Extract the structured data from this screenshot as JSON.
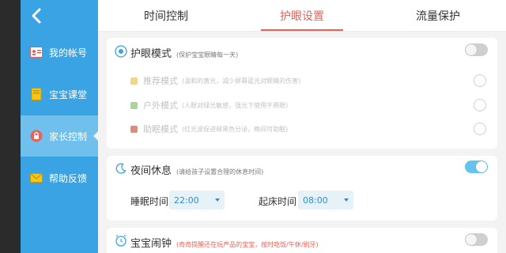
{
  "sidebar": {
    "items": [
      {
        "label": "我的帐号",
        "icon": "account-card-icon"
      },
      {
        "label": "宝宝课堂",
        "icon": "notebook-icon"
      },
      {
        "label": "家长控制",
        "icon": "lock-icon",
        "active": true
      },
      {
        "label": "帮助反馈",
        "icon": "envelope-icon"
      }
    ]
  },
  "tabs": [
    {
      "label": "时间控制"
    },
    {
      "label": "护眼设置",
      "active": true
    },
    {
      "label": "流量保护"
    }
  ],
  "eye_care": {
    "title": "护眼模式",
    "subtitle": "(保护宝宝眼睛每一天)",
    "enabled": false,
    "modes": [
      {
        "name": "推荐模式",
        "desc": "(温和的黄光，减少屏幕蓝光对眼睛的伤害)",
        "color": "#f2d58a"
      },
      {
        "name": "户外模式",
        "desc": "(人眼对绿光敏感，强光下使用不费眼)",
        "color": "#a9d59a"
      },
      {
        "name": "助眠模式",
        "desc": "(红光波促进褪黑色分泌，晚间可助眠)",
        "color": "#e08b7c"
      }
    ]
  },
  "night_rest": {
    "title": "夜间休息",
    "subtitle": "(请给孩子设置合理的休息时间)",
    "enabled": true,
    "sleep_label": "睡眠时间",
    "sleep_value": "22:00",
    "wake_label": "起床时间",
    "wake_value": "08:00"
  },
  "alarm": {
    "title": "宝宝闹钟",
    "subtitle": "(奇奇提醒还在玩产品的宝宝，按时吃饭/午休/刷牙)",
    "enabled": false
  },
  "colors": {
    "sidebar": "#3aa3e3",
    "accent_tab": "#e8625a",
    "toggle_on": "#66c3ee"
  }
}
